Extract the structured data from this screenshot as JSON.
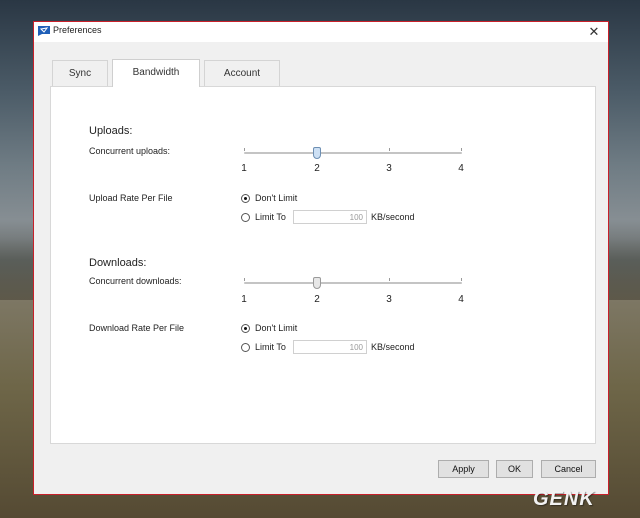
{
  "window": {
    "title": "Preferences",
    "close_icon": "close-icon",
    "app_icon": "app-icon",
    "accent": "#c8202a"
  },
  "tabs": [
    {
      "label": "Sync",
      "active": false
    },
    {
      "label": "Bandwidth",
      "active": true
    },
    {
      "label": "Account",
      "active": false
    }
  ],
  "uploads": {
    "heading": "Uploads:",
    "concurrent_label": "Concurrent uploads:",
    "ticks": [
      "1",
      "2",
      "3",
      "4"
    ],
    "concurrent_value": 2,
    "rate_label": "Upload Rate Per File",
    "option_dont_limit": "Don't Limit",
    "option_limit_to": "Limit To",
    "limit_value": "100",
    "unit": "KB/second",
    "selected": "dont_limit"
  },
  "downloads": {
    "heading": "Downloads:",
    "concurrent_label": "Concurrent downloads:",
    "ticks": [
      "1",
      "2",
      "3",
      "4"
    ],
    "concurrent_value": 2,
    "rate_label": "Download Rate Per File",
    "option_dont_limit": "Don't Limit",
    "option_limit_to": "Limit To",
    "limit_value": "100",
    "unit": "KB/second",
    "selected": "dont_limit"
  },
  "buttons": {
    "apply": "Apply",
    "ok": "OK",
    "cancel": "Cancel"
  },
  "watermark": "GENK"
}
